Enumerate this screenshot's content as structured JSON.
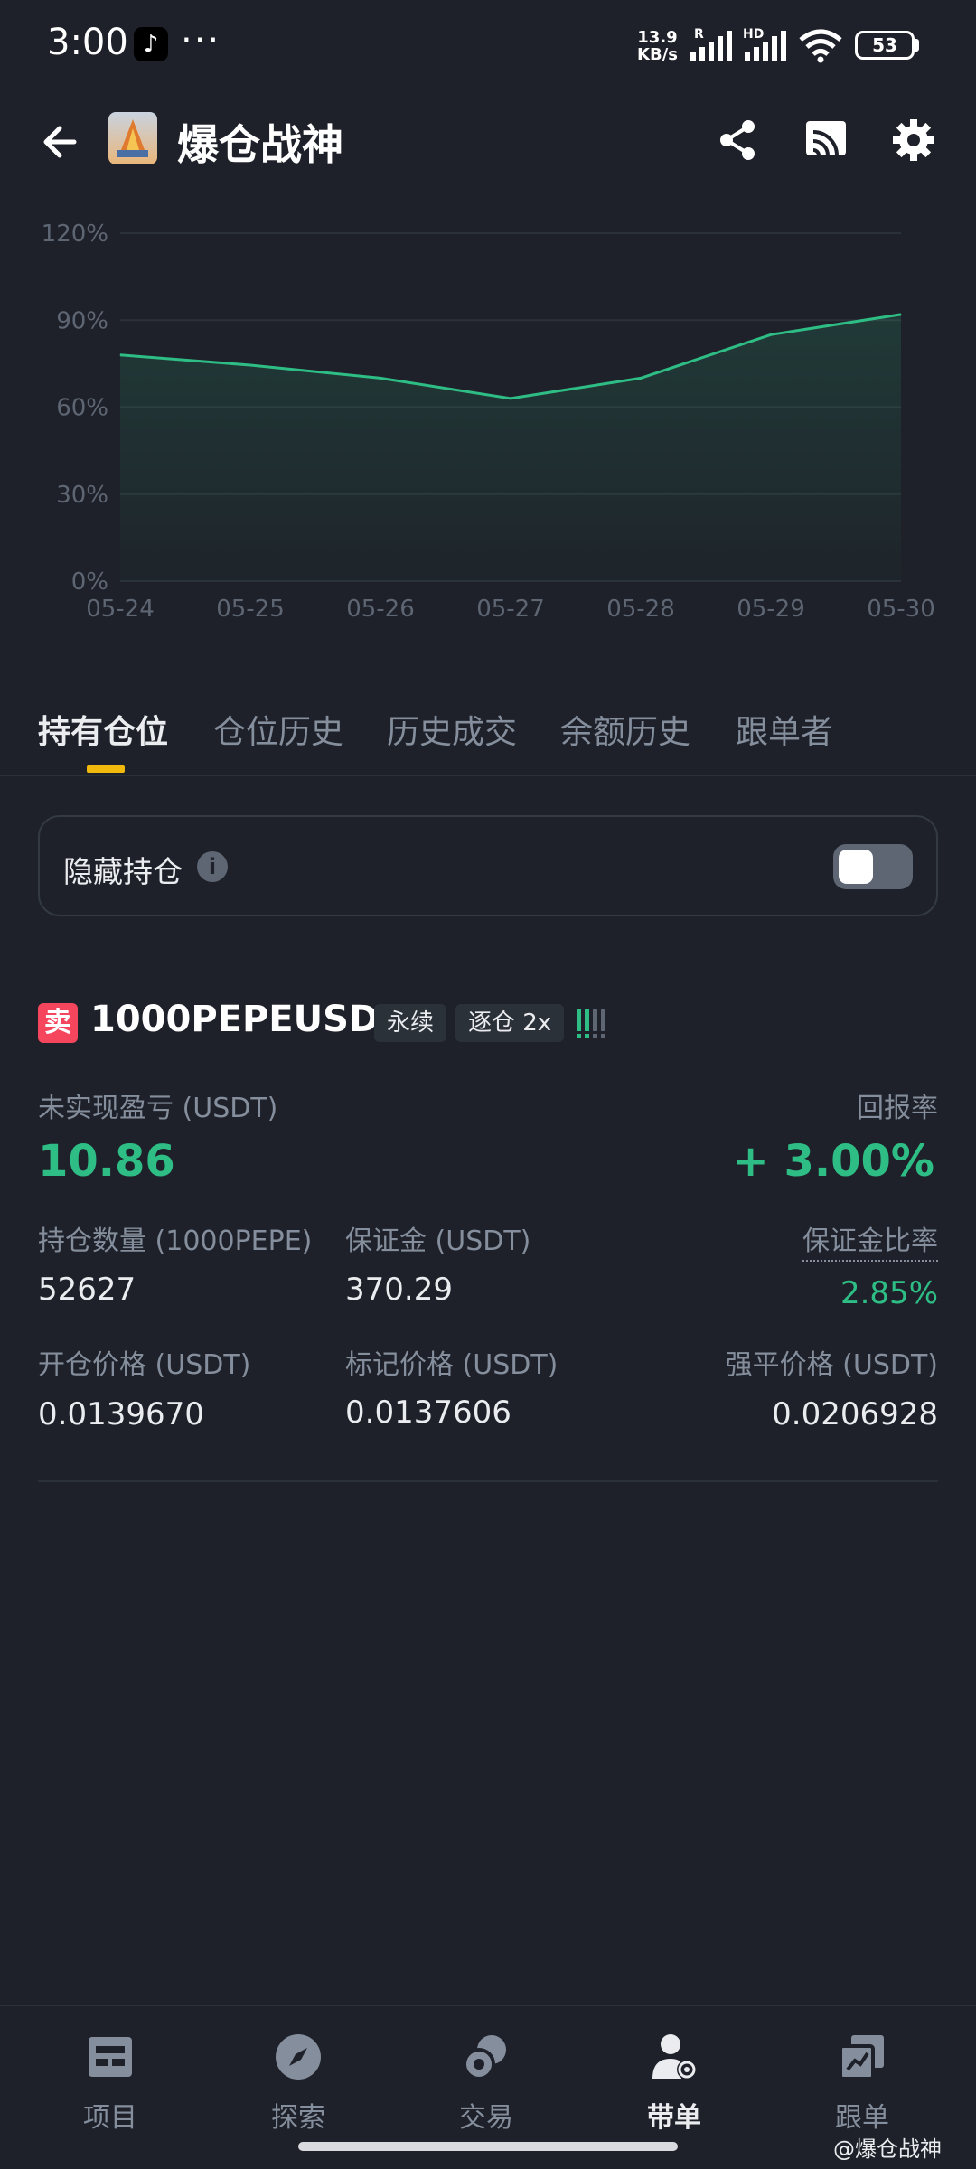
{
  "status_bar": {
    "time": "3:00",
    "dots": "···",
    "speed_value": "13.9",
    "speed_unit": "KB/s",
    "network_r": "R",
    "network_hd": "HD",
    "battery": "53"
  },
  "header": {
    "title": "爆仓战神",
    "icons": [
      "back-arrow-icon",
      "share-icon",
      "cast-icon",
      "gear-icon"
    ]
  },
  "chart_data": {
    "type": "area",
    "x": [
      "05-24",
      "05-25",
      "05-26",
      "05-27",
      "05-28",
      "05-29",
      "05-30"
    ],
    "series": [
      {
        "values": [
          78,
          74.5,
          70,
          63,
          70,
          85,
          92
        ]
      }
    ],
    "y_ticks": [
      "120%",
      "90%",
      "60%",
      "30%",
      "0%"
    ],
    "y_tick_values": [
      120,
      90,
      60,
      30,
      0
    ],
    "ylim": [
      0,
      120
    ],
    "grid": true,
    "line_color": "#2ebd85"
  },
  "tabs": [
    {
      "label": "持有仓位",
      "active": true
    },
    {
      "label": "仓位历史",
      "active": false
    },
    {
      "label": "历史成交",
      "active": false
    },
    {
      "label": "余额历史",
      "active": false
    },
    {
      "label": "跟单者",
      "active": false
    }
  ],
  "hide_positions": {
    "label": "隐藏持仓",
    "info_glyph": "i",
    "toggle_on": false
  },
  "position": {
    "side": "卖",
    "symbol": "1000PEPEUSDT",
    "tag_type": "永续",
    "tag_margin": "逐仓 2x",
    "unrealized_pnl_label": "未实现盈亏 (USDT)",
    "unrealized_pnl": "10.86",
    "roe_label": "回报率",
    "roe": "+ 3.00%",
    "size_label": "持仓数量 (1000PEPE)",
    "size": "52627",
    "margin_label": "保证金 (USDT)",
    "margin": "370.29",
    "margin_ratio_label": "保证金比率",
    "margin_ratio": "2.85%",
    "entry_label": "开仓价格 (USDT)",
    "entry": "0.0139670",
    "mark_label": "标记价格 (USDT)",
    "mark": "0.0137606",
    "liq_label": "强平价格 (USDT)",
    "liq": "0.0206928",
    "colors": {
      "sell": "#f6465d",
      "profit": "#2ebd85"
    }
  },
  "bottom_nav": [
    {
      "label": "项目",
      "icon": "project-icon",
      "active": false
    },
    {
      "label": "探索",
      "icon": "compass-icon",
      "active": false
    },
    {
      "label": "交易",
      "icon": "trade-icon",
      "active": false
    },
    {
      "label": "带单",
      "icon": "lead-trader-icon",
      "active": true
    },
    {
      "label": "跟单",
      "icon": "copy-trade-icon",
      "active": false
    }
  ],
  "watermark": "@爆仓战神"
}
